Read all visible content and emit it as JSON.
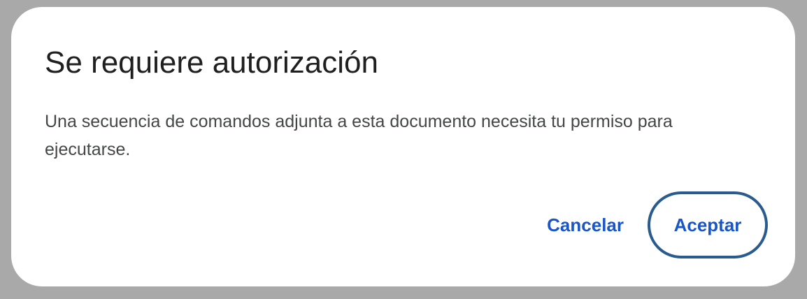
{
  "dialog": {
    "title": "Se requiere autorización",
    "message": "Una secuencia de comandos adjunta a esta documento necesita tu permiso para ejecutarse.",
    "cancel_label": "Cancelar",
    "accept_label": "Aceptar"
  },
  "colors": {
    "backdrop": "#a9a9a9",
    "surface": "#ffffff",
    "title": "#1f1f1f",
    "body_text": "#444746",
    "accent": "#1a56c7",
    "focus_ring": "#2a5b8f"
  }
}
